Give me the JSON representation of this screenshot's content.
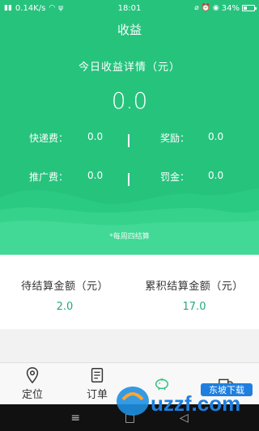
{
  "status_bar": {
    "speed": "0.14K/s",
    "time": "18:01",
    "battery_percent": "34%",
    "battery_level": 0.34
  },
  "header": {
    "title": "收益",
    "detail_title": "今日收益详情（元）",
    "total": "0.0"
  },
  "stats": {
    "courier_fee_label": "快递费：",
    "courier_fee_value": "0.0",
    "reward_label": "奖励：",
    "reward_value": "0.0",
    "promo_fee_label": "推广费：",
    "promo_fee_value": "0.0",
    "penalty_label": "罚金：",
    "penalty_value": "0.0",
    "separator": "|"
  },
  "note": "*每周四结算",
  "settlement": {
    "pending_label": "待结算金额（元）",
    "pending_value": "2.0",
    "cumulative_label": "累积结算金额（元）",
    "cumulative_value": "17.0"
  },
  "nav": {
    "items": [
      {
        "label": "定位",
        "icon": "location-pin-icon"
      },
      {
        "label": "订单",
        "icon": "order-document-icon"
      },
      {
        "label": "",
        "icon": "piggy-bank-icon"
      },
      {
        "label": "",
        "icon": "delivery-truck-icon"
      }
    ],
    "active_index": 2
  },
  "watermark": {
    "brand": "uzzf.com",
    "cn": "东坡下载"
  },
  "colors": {
    "primary": "#26c37d",
    "value_green": "#26a87a"
  }
}
